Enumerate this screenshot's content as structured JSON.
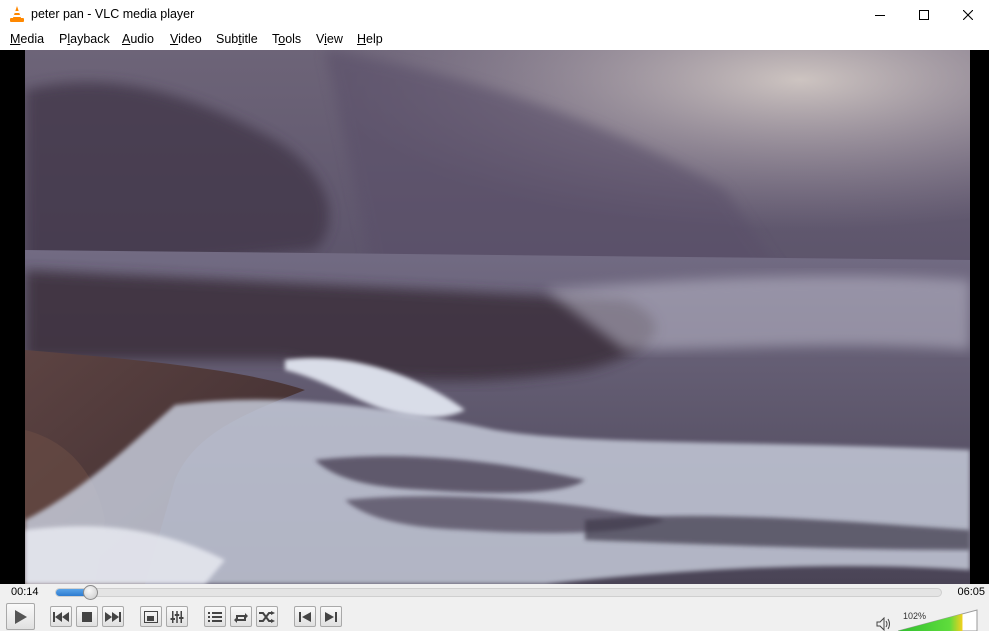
{
  "window": {
    "title": "peter pan - VLC media player",
    "controls": [
      "minimize-icon",
      "maximize-icon",
      "close-icon"
    ]
  },
  "menu": {
    "items": [
      {
        "label": "Media",
        "mnemonic": "M"
      },
      {
        "label": "Playback",
        "mnemonic": "l"
      },
      {
        "label": "Audio",
        "mnemonic": "A"
      },
      {
        "label": "Video",
        "mnemonic": "V"
      },
      {
        "label": "Subtitle",
        "mnemonic": "t"
      },
      {
        "label": "Tools",
        "mnemonic": "o"
      },
      {
        "label": "View",
        "mnemonic": "i"
      },
      {
        "label": "Help",
        "mnemonic": "H"
      }
    ]
  },
  "playback": {
    "elapsed": "00:14",
    "total": "06:05",
    "progress_fraction": 0.038
  },
  "controls": {
    "buttons": [
      {
        "name": "play-button",
        "icon": "play-icon"
      },
      {
        "name": "previous-chapter-button",
        "icon": "skip-back-icon"
      },
      {
        "name": "stop-button",
        "icon": "stop-icon"
      },
      {
        "name": "next-chapter-button",
        "icon": "skip-forward-icon"
      },
      {
        "name": "fullscreen-button",
        "icon": "fullscreen-icon"
      },
      {
        "name": "extended-settings-button",
        "icon": "equalizer-icon"
      },
      {
        "name": "playlist-button",
        "icon": "playlist-icon"
      },
      {
        "name": "loop-button",
        "icon": "loop-icon"
      },
      {
        "name": "shuffle-button",
        "icon": "shuffle-icon"
      },
      {
        "name": "previous-frame-button",
        "icon": "frame-back-icon"
      },
      {
        "name": "next-frame-button",
        "icon": "frame-forward-icon"
      }
    ]
  },
  "volume": {
    "label": "102%",
    "level_percent": 102,
    "icon": "speaker-icon"
  },
  "colors": {
    "accent": "#ff8800",
    "seek_fill": "#2d7bd0",
    "volume_green": "#3cc83c"
  }
}
